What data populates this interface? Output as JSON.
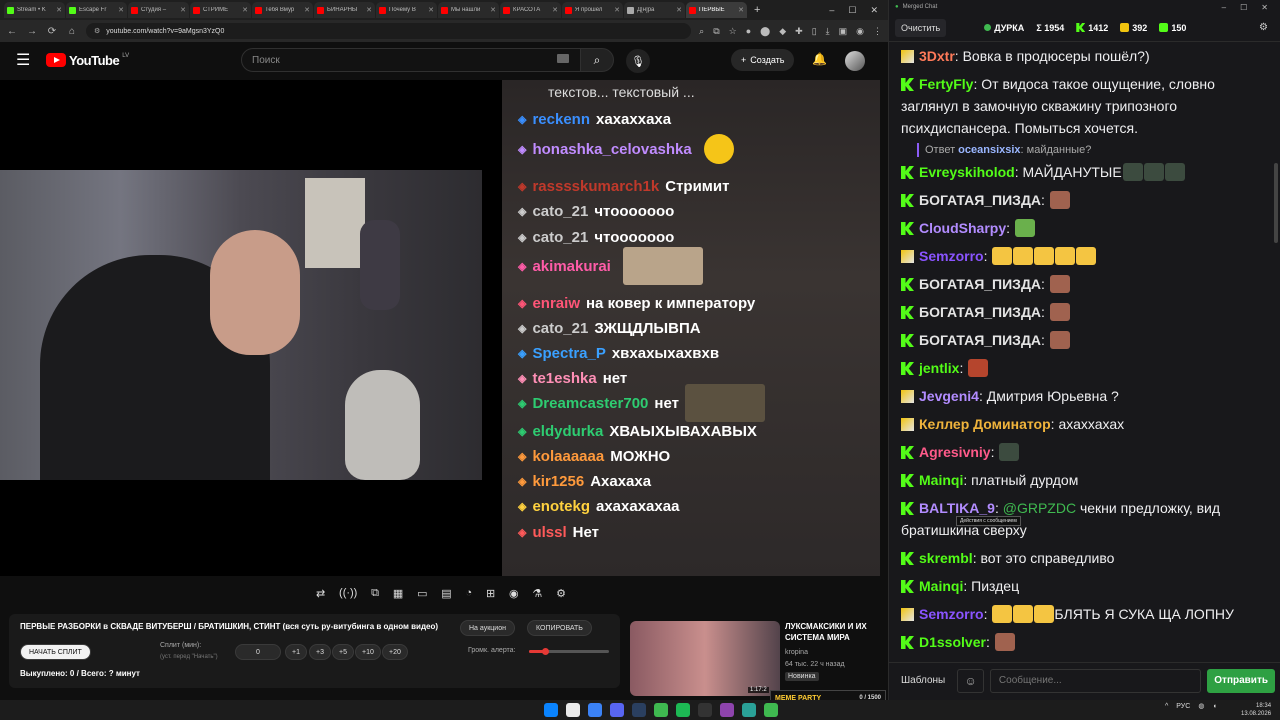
{
  "browser": {
    "tabs": [
      {
        "label": "Stream • K",
        "color": "#53fc18"
      },
      {
        "label": "Escape Fr",
        "color": "#53fc18"
      },
      {
        "label": "Студия –",
        "color": "#ff0000"
      },
      {
        "label": "СТРИМЕ",
        "color": "#ff0000"
      },
      {
        "label": "Тебя Вмур",
        "color": "#ff0000"
      },
      {
        "label": "БИНАРНЫ",
        "color": "#ff0000"
      },
      {
        "label": "Почему В",
        "color": "#ff0000"
      },
      {
        "label": "Мы нашли",
        "color": "#ff0000"
      },
      {
        "label": "КРАСОТА",
        "color": "#ff0000"
      },
      {
        "label": "Я прошел",
        "color": "#ff0000"
      },
      {
        "label": "Д[н]ра",
        "color": "#aaaaaa"
      },
      {
        "label": "ПЕРВЫЕ",
        "color": "#ff0000"
      }
    ],
    "new_tab": "+",
    "win_min": "–",
    "win_max": "☐",
    "win_close": "✕",
    "url": "youtube.com/watch?v=9aMgsn3YzQ0"
  },
  "youtube": {
    "logo": "YouTube",
    "region": "LV",
    "search_placeholder": "Поиск",
    "create_label": "Создать",
    "create_plus": "+"
  },
  "overlay": {
    "header": "текстов...      текстовый ...",
    "lines": [
      {
        "user": "reckenn",
        "color": "#3a8fff",
        "msg": "хахаххаха",
        "emote": false
      },
      {
        "user": "honashka_celovashka",
        "color": "#c08cff",
        "msg": "",
        "emote": true,
        "emote_color": "#f5c518"
      },
      {
        "user": "rasssskumarch1k",
        "color": "#c0392b",
        "msg": "Стримит",
        "emote": false
      },
      {
        "user": "cato_21",
        "color": "#cccccc",
        "msg": "чтооооооо",
        "emote": false
      },
      {
        "user": "cato_21",
        "color": "#cccccc",
        "msg": "чтооооооо",
        "emote": false
      },
      {
        "user": "akimakurai",
        "color": "#ff5ca8",
        "msg": "",
        "emote": true,
        "emote_color": "#b9a48a"
      },
      {
        "user": "enraiw",
        "color": "#ff5577",
        "msg": "на ковер к императору",
        "emote": false
      },
      {
        "user": "cato_21",
        "color": "#cccccc",
        "msg": "ЗЖЩДЛЫВПА",
        "emote": false
      },
      {
        "user": "Spectra_P",
        "color": "#3aa0ff",
        "msg": "хвхахыхахвхв",
        "emote": false
      },
      {
        "user": "te1eshka",
        "color": "#ff8fb6",
        "msg": "нет",
        "emote": false
      },
      {
        "user": "Dreamcaster700",
        "color": "#2ecc71",
        "msg": "нет",
        "emote": true,
        "emote_color": "#5b5140"
      },
      {
        "user": "eldydurka",
        "color": "#2ecc71",
        "msg": "ХВАЫХЫВАХАВЫХ",
        "emote": false
      },
      {
        "user": "kolaaaaaa",
        "color": "#ff9a3c",
        "msg": "МОЖНО",
        "emote": false
      },
      {
        "user": "kir1256",
        "color": "#ff9a3c",
        "msg": "Ахахаха",
        "emote": false
      },
      {
        "user": "enotekg",
        "color": "#ffd23f",
        "msg": "ахахахахаа",
        "emote": false
      },
      {
        "user": "ulssl",
        "color": "#ff5a5a",
        "msg": "Нет",
        "emote": false
      }
    ]
  },
  "controls": [
    "⇄",
    "((·))",
    "⧉",
    "▦",
    "▭",
    "▤",
    "◔",
    "⊞",
    "◉",
    "⚗",
    "⚙"
  ],
  "panel": {
    "title": "ПЕРВЫЕ РАЗБОРКИ в СКВАДЕ ВИТУБЕРШ / БРАТИШКИН, СТИНТ (вся суть ру-витубинга в одном видео)",
    "auction_btn": "На аукцион",
    "copy_btn": "КОПИРОВАТЬ",
    "start_btn": "НАЧАТЬ СПЛИТ",
    "split_label": "Сплит (мин):",
    "split_hint": "(уст. перед \"Начать\")",
    "split_value": "0",
    "inc": [
      "+1",
      "+3",
      "+5",
      "+10",
      "+20"
    ],
    "volume_label": "Громк. алерта:",
    "volume_level": 0.2,
    "status": "Выкуплено: 0 / Всего: ? минут"
  },
  "recommendation": {
    "title": "ЛУКСМАКСИКИ И ИХ СИСТЕМА МИРА",
    "channel": "kropina",
    "meta": "64 тыс.   22 ч назад",
    "badge": "Новинка",
    "duration": "1:17:2"
  },
  "meme_widget": {
    "label": "MEME PARTY",
    "count": "0 / 1500"
  },
  "taskbar": {
    "icons": [
      "#0a84ff",
      "#eaeaea",
      "#3b82f6",
      "#5865f2",
      "#2a3f5f",
      "#3fb950",
      "#1db954",
      "#333333",
      "#8e44ad",
      "#2aa198",
      "#3fb950"
    ],
    "tray_lang": "РУС",
    "time": "18:34",
    "date": "13.08.2026"
  },
  "chat": {
    "window_title": "Merged Chat",
    "clear_btn": "Очистить",
    "streamer": "ДУРКА",
    "stat_total": "Σ 1954",
    "stat_kick": "1412",
    "stat_other": "392",
    "stat_other2": "150",
    "messages": [
      {
        "badge": "s",
        "nick": "3Dxtr",
        "color": "#ff7a59",
        "text": "Вовка в продюсеры пошёл?)",
        "emotes": []
      },
      {
        "badge": "k",
        "nick": "FertyFly",
        "color": "#53fc18",
        "text": "От видоса такое ощущение, словно заглянул в замочную скважину трипозного психдиспансера. Помыться хочется.",
        "emotes": []
      },
      {
        "badge": "k",
        "nick": "Evreyskiholod",
        "color": "#53fc18",
        "text": "МАЙДАНУТЫЕ",
        "emotes": [
          "#3c4b3f",
          "#3c4b3f",
          "#3c4b3f"
        ]
      },
      {
        "badge": "k",
        "nick": "БОГАТАЯ_ПИЗДА",
        "color": "#e5e5e5",
        "text": "",
        "emotes": [
          "#a0624f"
        ]
      },
      {
        "badge": "k",
        "nick": "CloudSharpy",
        "color": "#b28cff",
        "text": "",
        "emotes": [
          "#6ab04c"
        ]
      },
      {
        "badge": "s",
        "nick": "Semzorro",
        "color": "#8a54ff",
        "text": "",
        "emotes": [
          "#f4c542",
          "#f4c542",
          "#f4c542",
          "#f4c542",
          "#f4c542"
        ]
      },
      {
        "badge": "k",
        "nick": "БОГАТАЯ_ПИЗДА",
        "color": "#e5e5e5",
        "text": "",
        "emotes": [
          "#a0624f"
        ]
      },
      {
        "badge": "k",
        "nick": "БОГАТАЯ_ПИЗДА",
        "color": "#e5e5e5",
        "text": "",
        "emotes": [
          "#a0624f"
        ]
      },
      {
        "badge": "k",
        "nick": "БОГАТАЯ_ПИЗДА",
        "color": "#e5e5e5",
        "text": "",
        "emotes": [
          "#a0624f"
        ]
      },
      {
        "badge": "k",
        "nick": "jentlix",
        "color": "#53fc18",
        "text": "",
        "emotes": [
          "#b5452d"
        ]
      },
      {
        "badge": "s",
        "nick": "Jevgeni4",
        "color": "#b28cff",
        "text": "Дмитрия Юрьевна ?",
        "emotes": []
      },
      {
        "badge": "s",
        "nick": "Келлер Доминатор",
        "color": "#f0b43c",
        "text": "ахаххахах",
        "emotes": []
      },
      {
        "badge": "k",
        "nick": "Agresivniy",
        "color": "#ff5a8a",
        "text": "",
        "emotes": [
          "#3c4b3f"
        ]
      },
      {
        "badge": "k",
        "nick": "Mainqi",
        "color": "#53fc18",
        "text": "платный дурдом",
        "emotes": []
      },
      {
        "badge": "k",
        "nick": "BALTIKA_9",
        "color": "#b28cff",
        "text": "чекни предложку, вид братишкина сверху",
        "mention": "@GRPZDC",
        "emotes": []
      },
      {
        "badge": "k",
        "nick": "skrembl",
        "color": "#53fc18",
        "text": "вот это справедливо",
        "emotes": []
      },
      {
        "badge": "k",
        "nick": "Mainqi",
        "color": "#53fc18",
        "text": "Пиздец",
        "emotes": []
      },
      {
        "badge": "s",
        "nick": "Semzorro",
        "color": "#8a54ff",
        "text": "БЛЯТЬ Я СУКА ЩА ЛОПНУ",
        "emotes": [
          "#f4c542",
          "#f4c542",
          "#f4c542"
        ]
      },
      {
        "badge": "k",
        "nick": "D1ssolver",
        "color": "#53fc18",
        "text": "",
        "emotes": [
          "#a0624f"
        ]
      }
    ],
    "reply": {
      "label": "Ответ",
      "nick": "oceansixsix",
      "text": "майданные?"
    },
    "tooltip": "Действия с сообщением",
    "templates_btn": "Шаблоны",
    "input_placeholder": "Сообщение...",
    "send_btn": "Отправить"
  }
}
